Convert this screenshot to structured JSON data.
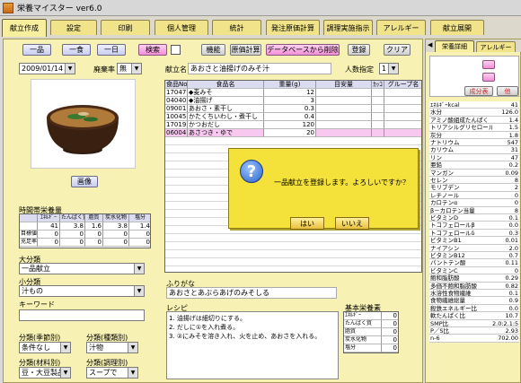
{
  "window": {
    "title": "栄養マイスター ver6.0"
  },
  "tabs": [
    {
      "label": "献立作成"
    },
    {
      "label": "設定"
    },
    {
      "label": "印刷"
    },
    {
      "label": "個人管理"
    },
    {
      "label": "統計"
    },
    {
      "label": "発注原価計算"
    },
    {
      "label": "調理実施指示"
    },
    {
      "label": "アレルギー"
    },
    {
      "label": "献立展開"
    }
  ],
  "toolbar": {
    "ippin": "一品",
    "isshoku": "一食",
    "ichinichi": "一日",
    "search": "検索",
    "function": "機能",
    "cost": "原価計算",
    "delete_db": "データベースから削除",
    "register": "登録",
    "clear": "クリア"
  },
  "form": {
    "date": "2009/01/14",
    "haikiritsu_label": "廃棄率",
    "haikiritsu_value": "無",
    "kondate_label": "献立名",
    "kondate_value": "あおさと油揚げのみそ汁",
    "ninzu_label": "人数指定",
    "ninzu_value": "1",
    "image_button": "画像"
  },
  "food_table": {
    "headers": [
      "食品No",
      "食品名",
      "重量(g)",
      "目安量",
      "ｶｯｺ",
      "グループ名"
    ],
    "rows": [
      {
        "no": "17047",
        "name": "◆麦みそ",
        "weight": "12"
      },
      {
        "no": "04040",
        "name": "◆油揚げ",
        "weight": "3"
      },
      {
        "no": "09001",
        "name": "あおさ・素干し",
        "weight": "0.3"
      },
      {
        "no": "10045",
        "name": "かたくちいわし・煮干し",
        "weight": "0.4"
      },
      {
        "no": "17019",
        "name": "かつおだし",
        "weight": "120"
      },
      {
        "no": "06004",
        "name": "あさつき・ゆで",
        "weight": "20"
      }
    ]
  },
  "nutrition_small": {
    "title": "時間帯栄養量",
    "headers": [
      "ｴﾈﾙｷﾞｰ",
      "たんぱく質",
      "脂質",
      "炭水化物",
      "塩分"
    ],
    "rows": [
      {
        "label": "",
        "values": [
          "41",
          "3.8",
          "1.6",
          "3.8",
          "1.4"
        ]
      },
      {
        "label": "目標値",
        "values": [
          "0",
          "0",
          "0",
          "0",
          "0"
        ]
      },
      {
        "label": "充足率",
        "values": [
          "0",
          "0",
          "0",
          "0",
          "0"
        ]
      }
    ]
  },
  "classification": {
    "daibunrui_label": "大分類",
    "daibunrui_value": "一品献立",
    "shobunrui_label": "小分類",
    "shobunrui_value": "汁もの",
    "keyword_label": "キーワード",
    "kisetsu_label": "分類(季節別)",
    "kisetsu_value": "条件なし",
    "shurui_label": "分類(種類別)",
    "shurui_value": "汁物",
    "zairyo_label": "分類(材料別)",
    "zairyo_value": "豆・大豆製品類",
    "chori_label": "分類(調理別)",
    "chori_value": "スープで"
  },
  "furigana": {
    "label": "ふりがな",
    "value": "あおさとあぶらあげのみそしる"
  },
  "recipe": {
    "label": "レシピ",
    "lines": [
      "1. 油揚げは細切りにする。",
      "2. だしに①を入れ煮る。",
      "3. ②にみそを溶き入れ、火を止め、あおさを入れる。"
    ]
  },
  "basic_nutrients": {
    "label": "基本栄養素",
    "rows": [
      {
        "name": "ｴﾈﾙｷﾞｰ",
        "value": "0"
      },
      {
        "name": "たんぱく質",
        "value": "0"
      },
      {
        "name": "脂質",
        "value": "0"
      },
      {
        "name": "炭水化物",
        "value": "0"
      },
      {
        "name": "塩分",
        "value": "0"
      }
    ]
  },
  "side": {
    "tab_active": "栄養詳細",
    "tab_other": "アレルギー",
    "btn_seibun": "成分表",
    "btn_ta": "他",
    "nutrients": [
      {
        "name": "ｴﾈﾙｷﾞｰkcal",
        "value": "41"
      },
      {
        "name": "水分",
        "value": "126.0"
      },
      {
        "name": "アミノ酸組成たんぱく",
        "value": "1.4"
      },
      {
        "name": "トリアシルグリセロール当量",
        "value": "1.5"
      },
      {
        "name": "灰分",
        "value": "1.8"
      },
      {
        "name": "ナトリウム",
        "value": "547"
      },
      {
        "name": "カリウム",
        "value": "31"
      },
      {
        "name": "リン",
        "value": "47"
      },
      {
        "name": "亜鉛",
        "value": "0.2"
      },
      {
        "name": "マンガン",
        "value": "0.09"
      },
      {
        "name": "セレン",
        "value": "8"
      },
      {
        "name": "モリブデン",
        "value": "2"
      },
      {
        "name": "レチノール",
        "value": "0"
      },
      {
        "name": "カロテンα",
        "value": "0"
      },
      {
        "name": "β－カロテン当量",
        "value": "8"
      },
      {
        "name": "ビタミンD",
        "value": "0.1"
      },
      {
        "name": "トコフェロールβ",
        "value": "0.0"
      },
      {
        "name": "トコフェロールδ",
        "value": "0.3"
      },
      {
        "name": "ビタミンB1",
        "value": "0.01"
      },
      {
        "name": "ナイアシン",
        "value": "2.0"
      },
      {
        "name": "ビタミンB12",
        "value": "0.7"
      },
      {
        "name": "パントテン酸",
        "value": "0.11"
      },
      {
        "name": "ビタミンC",
        "value": "0"
      },
      {
        "name": "飽和脂肪酸",
        "value": "0.29"
      },
      {
        "name": "多価不飽和脂肪酸",
        "value": "0.82"
      },
      {
        "name": "水溶性食物繊維",
        "value": "0.1"
      },
      {
        "name": "食物繊維総量",
        "value": "0.9"
      },
      {
        "name": "殺鉄エネルギー比",
        "value": "0.0"
      },
      {
        "name": "軟たんぱく比",
        "value": "10.7"
      },
      {
        "name": "SMP比",
        "value": "2.0:2.1:5.9"
      },
      {
        "name": "P／S比",
        "value": "2.93"
      },
      {
        "name": "n-6",
        "value": "702.00"
      }
    ]
  },
  "dialog": {
    "message": "一品献立を登録します。よろしいですか？",
    "yes": "はい",
    "no": "いいえ"
  }
}
